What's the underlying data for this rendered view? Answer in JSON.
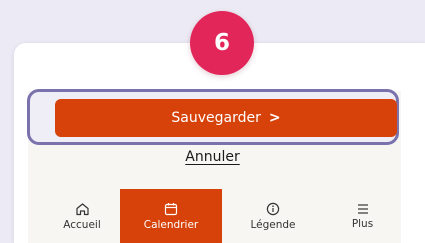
{
  "step": {
    "number": "6"
  },
  "actions": {
    "save_label": "Sauvegarder",
    "save_chevron": ">",
    "cancel_label": "Annuler"
  },
  "bottom_nav": {
    "items": [
      {
        "label": "Accueil",
        "icon": "home-icon",
        "active": false
      },
      {
        "label": "Calendrier",
        "icon": "calendar-icon",
        "active": true
      },
      {
        "label": "Légende",
        "icon": "info-icon",
        "active": false
      },
      {
        "label": "Plus",
        "icon": "menu-icon",
        "active": false
      }
    ]
  },
  "colors": {
    "accent": "#d64209",
    "badge": "#e3265a",
    "highlight_border": "#7a72ad",
    "page_background": "#eceaf4"
  }
}
